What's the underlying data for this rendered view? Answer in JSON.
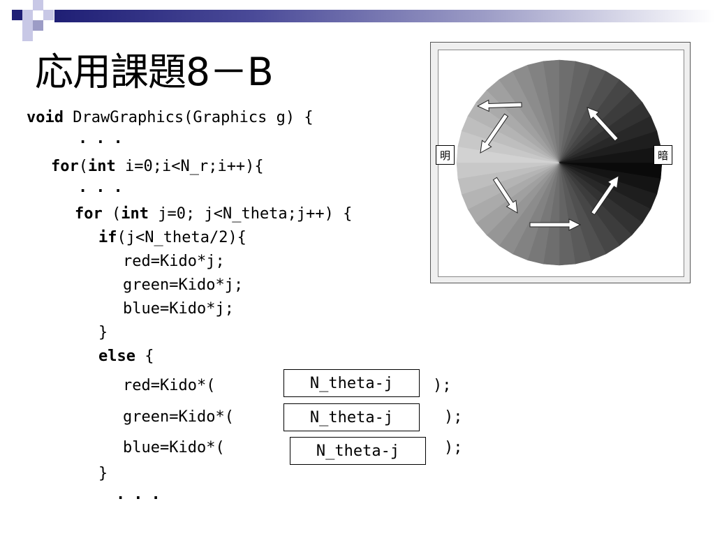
{
  "title": "応用課題8－B",
  "code": {
    "l1_kw": "void",
    "l1_rest": " DrawGraphics(Graphics g) {",
    "dots": "...",
    "for1_kw": "for",
    "for1_p1": "(",
    "for1_int": "int",
    "for1_rest": " i=0;i<N_r;i++){",
    "for2_kw": "for",
    "for2_p1": " (",
    "for2_int": "int",
    "for2_rest": " j=0; j<N_theta;j++) {",
    "if_kw": "if",
    "if_rest": "(j<N_theta/2){",
    "red1": "red=Kido*j;",
    "green1": "green=Kido*j;",
    "blue1": "blue=Kido*j;",
    "close_brace": "}",
    "else_kw": "else",
    "else_rest": " {",
    "red2": "red=Kido*(",
    "green2": "green=Kido*(",
    "blue2": "blue=Kido*(",
    "end_paren": ");"
  },
  "answers": {
    "red": "N_theta-j",
    "green": "N_theta-j",
    "blue": "N_theta-j"
  },
  "figure": {
    "label_left": "明",
    "label_right": "暗"
  }
}
